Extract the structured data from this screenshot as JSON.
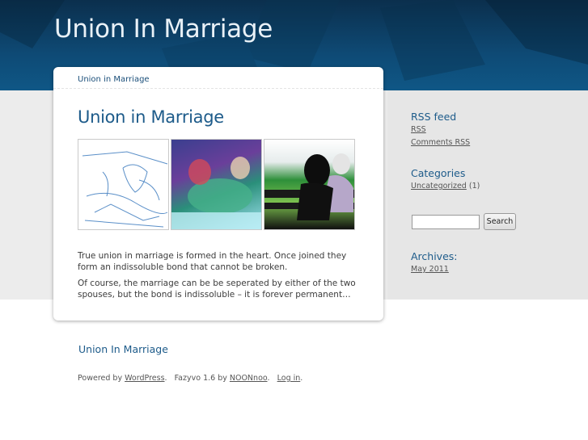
{
  "header": {
    "site_title": "Union In Marriage"
  },
  "post": {
    "breadcrumb": "Union in Marriage",
    "title": "Union in Marriage",
    "paragraph_1": "True union in marriage is formed in the heart. Once joined they form an indissoluble bond that cannot be broken.",
    "paragraph_2": "Of course, the marriage can be be seperated by either of the two spouses, but the bond is indissoluble – it is forever permanent…"
  },
  "sidebar": {
    "rss_heading": "RSS feed",
    "rss_link": "RSS",
    "comments_rss_link": "Comments RSS",
    "categories_heading": "Categories",
    "category_link": "Uncategorized",
    "category_count": " (1)",
    "search_button": "Search",
    "search_value": "",
    "archives_heading": "Archives:",
    "archive_link": "May 2011"
  },
  "footer": {
    "title": "Union In Marriage",
    "powered_by": "Powered by ",
    "wordpress": "WordPress",
    "theme_text": ".   Fazyvo 1.6 by ",
    "author": "NOONnoo",
    "sep": ".   ",
    "login": "Log in",
    "end": "."
  }
}
